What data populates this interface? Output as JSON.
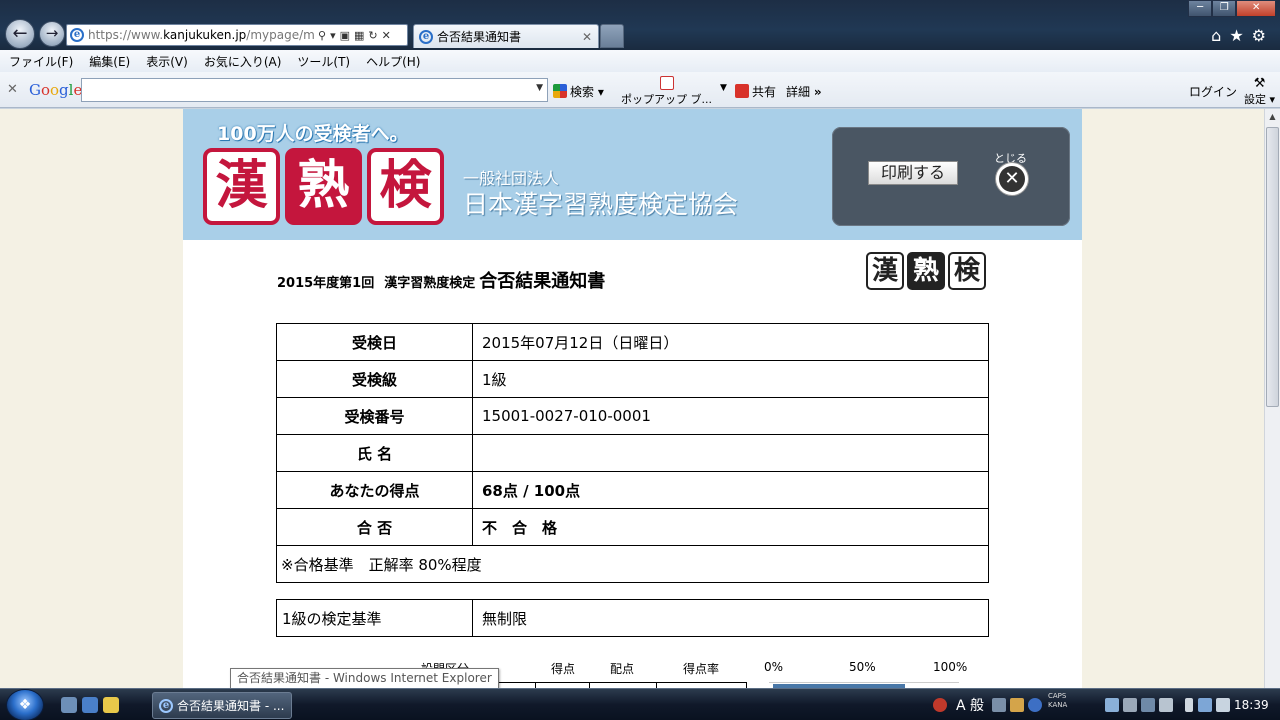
{
  "browser": {
    "url_prefix": "https://www.",
    "url_domain": "kanjukuken.jp",
    "url_path": "/mypage/my",
    "tab_title": "合否結果通知書",
    "menu": [
      "ファイル(F)",
      "編集(E)",
      "表示(V)",
      "お気に入り(A)",
      "ツール(T)",
      "ヘルプ(H)"
    ],
    "toolbar": {
      "google_logo": "Google",
      "search_label": "検索",
      "popup_label": "ポップアップ ブ...",
      "share_label": "共有",
      "more_label": "詳細",
      "login_label": "ログイン",
      "settings_label": "設定"
    }
  },
  "banner": {
    "slogan": "100万人の受検者へ。",
    "logo_chars": [
      "漢",
      "熟",
      "検"
    ],
    "org_sub": "一般社団法人",
    "org_name": "日本漢字習熟度検定協会",
    "print_button": "印刷する",
    "close_label": "とじる"
  },
  "document": {
    "year_round": "2015年度第1回",
    "exam_name": "漢字習熟度検定",
    "title": "合否結果通知書",
    "rows": [
      {
        "label": "受検日",
        "value": "2015年07月12日（日曜日）"
      },
      {
        "label": "受検級",
        "value": "1級"
      },
      {
        "label": "受検番号",
        "value": "15001-0027-010-0001"
      },
      {
        "label": "氏 名",
        "value": ""
      },
      {
        "label": "あなたの得点",
        "value": "68点 / 100点"
      },
      {
        "label": "合 否",
        "value": "不　合　格"
      }
    ],
    "note": "※合格基準　正解率 80%程度",
    "basis_label": "1級の検定基準",
    "basis_value": "無制限",
    "score_table_headers": [
      "設問区分",
      "得点",
      "配点",
      "得点率"
    ],
    "chart_axis": [
      "0%",
      "50%",
      "100%"
    ]
  },
  "tooltip": "合否結果通知書 - Windows Internet Explorer",
  "taskbar": {
    "task_label": "合否結果通知書 - ...",
    "ime": "A 般",
    "caps": "CAPS",
    "kana": "KANA",
    "clock": "18:39"
  },
  "colors": {
    "brand_red": "#c4163d",
    "banner_blue": "#a9cfe8",
    "page_bg": "#f4f1e4"
  }
}
